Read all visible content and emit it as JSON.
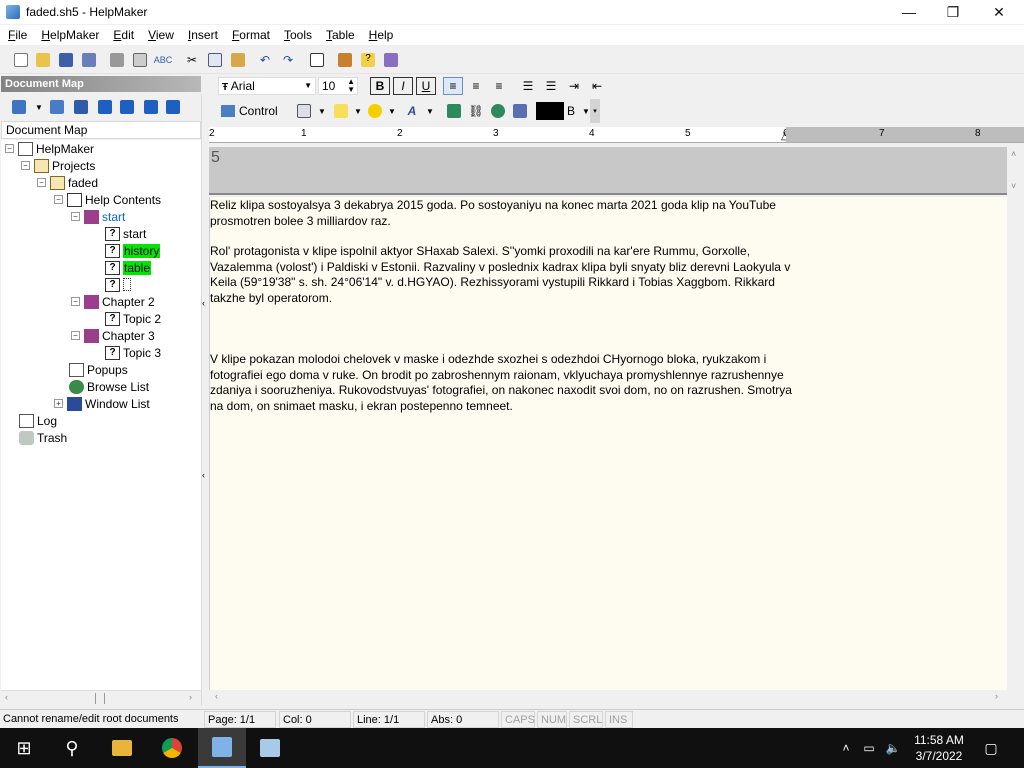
{
  "window": {
    "title": "faded.sh5 - HelpMaker",
    "minimize": "—",
    "maximize": "❐",
    "close": "✕"
  },
  "menu": [
    "File",
    "HelpMaker",
    "Edit",
    "View",
    "Insert",
    "Format",
    "Tools",
    "Table",
    "Help"
  ],
  "docmap": {
    "header": "Document Map",
    "label": "Document Map"
  },
  "tree": {
    "root": "HelpMaker",
    "projects": "Projects",
    "faded": "faded",
    "help_contents": "Help Contents",
    "start_book": "start",
    "start_topic": "start",
    "history": "history",
    "table": "table",
    "blank_topic": "",
    "chapter2": "Chapter 2",
    "topic2": "Topic 2",
    "chapter3": "Chapter 3",
    "topic3": "Topic 3",
    "popups": "Popups",
    "browse_list": "Browse List",
    "window_list": "Window List",
    "log": "Log",
    "trash": "Trash"
  },
  "format": {
    "font": "Arial",
    "size": "10",
    "control_label": "Control",
    "color_label": "B"
  },
  "ruler": [
    "2",
    "1",
    "2",
    "3",
    "4",
    "5",
    "6",
    "7",
    "8"
  ],
  "header_text": "5",
  "editor": {
    "p1": "Reliz klipa sostoyalsya 3 dekabrya 2015 goda. Po sostoyaniyu na konec marta 2021 goda klip na YouTube prosmotren bolee 3 milliardov raz.",
    "p2": "Rol' protagonista v klipe ispolnil aktyor SHaxab Salexi. S''yomki proxodili na kar'ere Rummu, Gorxolle, Vazalemma (volost') i Paldiski v Estonii. Razvaliny v poslednix kadrax klipa byli snyaty bliz derevni Laokyula v Keila (59°19'38\" s. sh. 24°06'14\" v. d.HGYAO). Rezhissyorami vystupili Rikkard i Tobias Xaggbom. Rikkard takzhe byl operatorom.",
    "p3": "V klipe pokazan molodoi chelovek v maske i odezhde sxozhei s odezhdoi CHyornogo bloka, ryukzakom i fotografiei ego doma v ruke. On brodit po zabroshennym raionam, vklyuchaya promyshlennye razrushennye zdaniya i sooruzheniya. Rukovodstvuyas' fotografiei, on nakonec naxodit svoi dom, no on razrushen. Smotrya na dom, on snimaet masku, i ekran postepenno temneet."
  },
  "status": {
    "message": "Cannot rename/edit root documents",
    "page": "Page: 1/1",
    "col": "Col: 0",
    "line": "Line: 1/1",
    "abs": "Abs: 0",
    "caps": "CAPS",
    "num": "NUM",
    "scrl": "SCRL",
    "ins": "INS"
  },
  "taskbar": {
    "time": "11:58 AM",
    "date": "3/7/2022"
  },
  "colors": {
    "highlight_green": "#00e600",
    "selected_node": "#0a64d6",
    "editor_bg": "#fefcf1",
    "header_pane": "#c8c8c8"
  }
}
